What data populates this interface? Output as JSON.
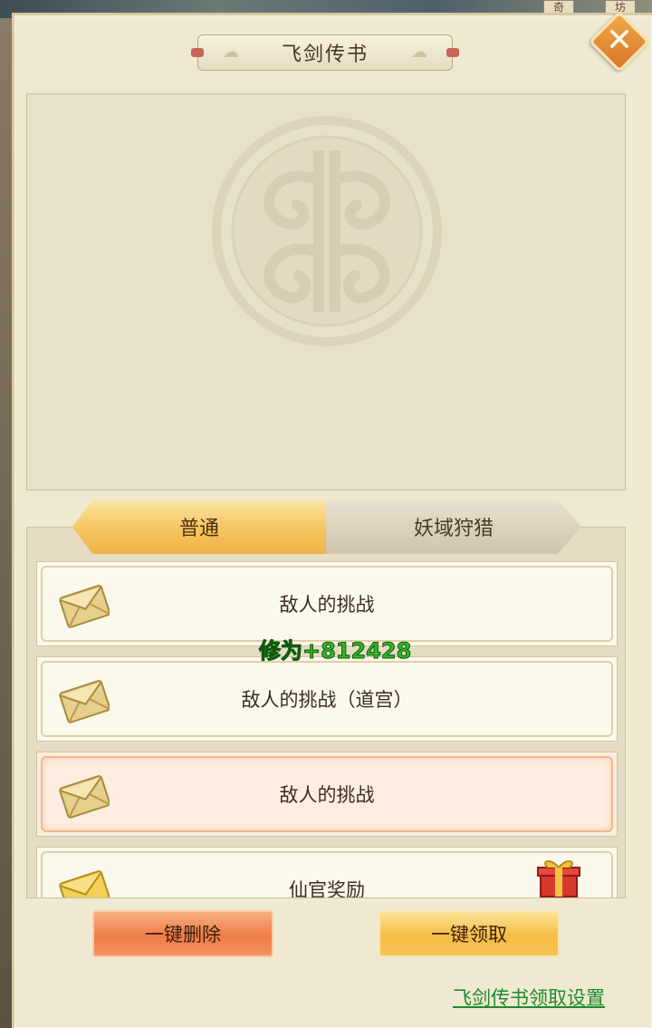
{
  "background": {
    "tags": [
      "奇",
      "坊"
    ]
  },
  "dialog": {
    "title": "飞剑传书",
    "close_label": "✕"
  },
  "tabs": [
    {
      "label": "普通",
      "active": true
    },
    {
      "label": "妖域狩猎",
      "active": false
    }
  ],
  "mails": [
    {
      "title": "敌人的挑战",
      "icon": "envelope-icon",
      "highlighted": false,
      "has_gift": false
    },
    {
      "title": "敌人的挑战（道宫）",
      "icon": "envelope-icon",
      "highlighted": false,
      "has_gift": false
    },
    {
      "title": "敌人的挑战",
      "icon": "envelope-icon",
      "highlighted": true,
      "has_gift": false
    },
    {
      "title": "仙官奖励",
      "icon": "envelope-icon",
      "highlighted": false,
      "has_gift": true
    }
  ],
  "floating_text": "修为+812428",
  "buttons": {
    "delete_all": "一键删除",
    "claim_all": "一键领取"
  },
  "settings_link": "飞剑传书领取设置",
  "colors": {
    "panel_bg": "#efe9d2",
    "active_tab": "#f5c45c",
    "delete_button": "#ef7c48",
    "claim_button": "#f6bd43",
    "exp_text": "#2fb72a",
    "link_text": "#1f8a2a"
  }
}
